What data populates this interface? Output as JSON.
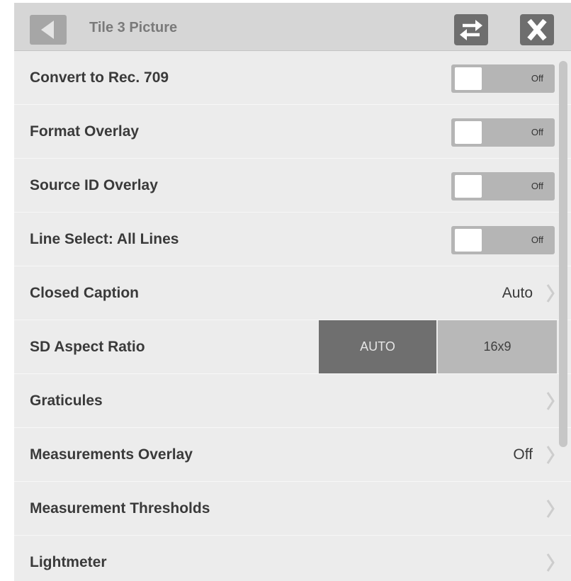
{
  "header": {
    "title": "Tile 3 Picture"
  },
  "rows": [
    {
      "label": "Convert to Rec. 709",
      "toggle": "Off"
    },
    {
      "label": "Format Overlay",
      "toggle": "Off"
    },
    {
      "label": "Source ID Overlay",
      "toggle": "Off"
    },
    {
      "label": "Line Select: All Lines",
      "toggle": "Off"
    },
    {
      "label": "Closed Caption",
      "value": "Auto"
    },
    {
      "label": "SD Aspect Ratio",
      "options": [
        "AUTO",
        "16x9"
      ],
      "selected": "AUTO"
    },
    {
      "label": "Graticules"
    },
    {
      "label": "Measurements Overlay",
      "value": "Off"
    },
    {
      "label": "Measurement Thresholds"
    },
    {
      "label": "Lightmeter"
    }
  ],
  "icons": {
    "back": "back-arrow-icon",
    "swap": "swap-arrows-icon",
    "close": "close-x-icon",
    "chevron": "chevron-right-icon"
  },
  "colors": {
    "header_bg": "#d6d6d6",
    "panel_bg": "#ececec",
    "button_bg": "#6e6e6e",
    "toggle_bg": "#b5b5b5",
    "segment_selected": "#6f6f6f",
    "segment_unselected": "#b8b8b8"
  }
}
